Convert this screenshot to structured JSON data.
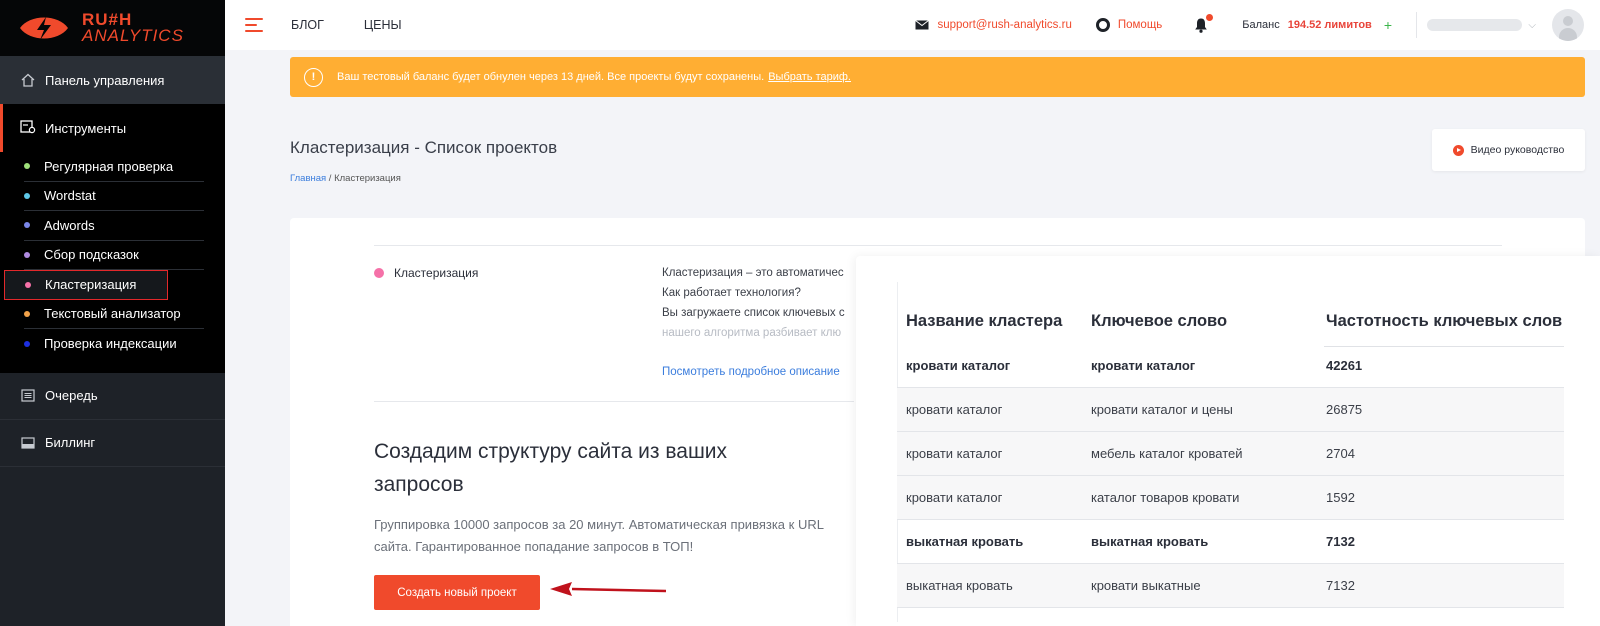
{
  "logo": {
    "line1": "RU#H",
    "line2": "ANALYTICS"
  },
  "sidebar": {
    "dashboard": "Панель управления",
    "tools": "Инструменты",
    "tools_items": [
      {
        "label": "Регулярная проверка",
        "color": "#9fe07a"
      },
      {
        "label": "Wordstat",
        "color": "#5ec8e8"
      },
      {
        "label": "Adwords",
        "color": "#7a86e8"
      },
      {
        "label": "Сбор подсказок",
        "color": "#b08be0"
      },
      {
        "label": "Кластеризация",
        "color": "#f571a8"
      },
      {
        "label": "Текстовый анализатор",
        "color": "#f2a24a"
      },
      {
        "label": "Проверка индексации",
        "color": "#1d2fe0"
      }
    ],
    "queue": "Очередь",
    "billing": "Биллинг"
  },
  "header": {
    "links": [
      "БЛОГ",
      "ЦЕНЫ"
    ],
    "support_email": "support@rush-analytics.ru",
    "help": "Помощь",
    "balance_label": "Баланс",
    "balance_value": "194.52 лимитов",
    "plus": "+"
  },
  "alert": {
    "text": "Ваш тестовый баланс будет обнулен через 13 дней. Все проекты будут сохранены.",
    "link": "Выбрать тариф.",
    "icon": "!"
  },
  "page": {
    "title": "Кластеризация - Список проектов",
    "breadcrumb_home": "Главная",
    "breadcrumb_sep": " / ",
    "breadcrumb_current": "Кластеризация",
    "video_button": "Видео руководство"
  },
  "card": {
    "section_label": "Кластеризация",
    "desc_lines": [
      "Кластеризация – это автоматичес",
      "Как работает технология?",
      "Вы загружаете список ключевых с",
      "нашего алгоритма разбивает клю"
    ],
    "more_link": "Посмотреть подробное описание",
    "heading": "Создадим структуру сайта из ваших запросов",
    "subtext": "Группировка 10000 запросов за 20 минут. Автоматическая привязка к URL сайта. Гарантированное попадание запросов в ТОП!",
    "cta": "Создать новый проект"
  },
  "demo_table": {
    "headers": [
      "Название кластера",
      "Ключевое слово",
      "Частотность ключевых слов"
    ],
    "rows": [
      {
        "cluster": "кровати каталог",
        "keyword": "кровати каталог",
        "freq": "42261",
        "bold": true
      },
      {
        "cluster": "кровати каталог",
        "keyword": "кровати каталог и цены",
        "freq": "26875",
        "bold": false
      },
      {
        "cluster": "кровати каталог",
        "keyword": "мебель каталог кроватей",
        "freq": "2704",
        "bold": false
      },
      {
        "cluster": "кровати каталог",
        "keyword": "каталог товаров кровати",
        "freq": "1592",
        "bold": false
      },
      {
        "cluster": "выкатная кровать",
        "keyword": "выкатная кровать",
        "freq": "7132",
        "bold": true
      },
      {
        "cluster": "выкатная кровать",
        "keyword": "кровати выкатные",
        "freq": "7132",
        "bold": false
      }
    ]
  }
}
